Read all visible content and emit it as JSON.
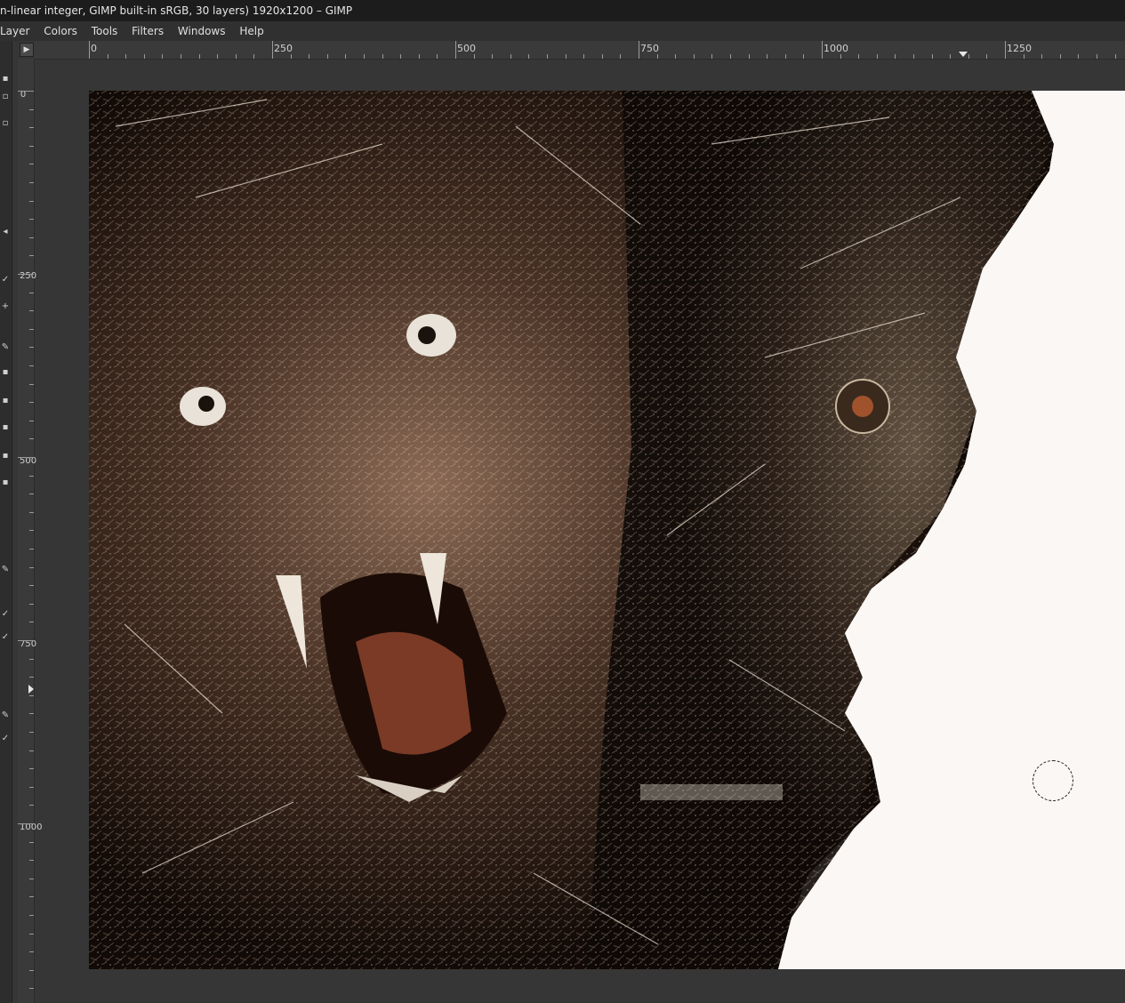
{
  "window": {
    "title": "n-linear integer, GIMP built-in sRGB, 30 layers) 1920x1200 – GIMP"
  },
  "menubar": {
    "items": [
      "Layer",
      "Colors",
      "Tools",
      "Filters",
      "Windows",
      "Help"
    ]
  },
  "rulers": {
    "horizontal_labels": [
      "0",
      "250",
      "500",
      "750",
      "1000",
      "1250"
    ],
    "vertical_labels": [
      "0",
      "250",
      "500",
      "750",
      "1000"
    ]
  },
  "canvas": {
    "background_color": "#fbf7f4",
    "artwork_description_icon": "tiger-skull-artwork"
  },
  "colors": {
    "ui_dark": "#1c1c1c",
    "ui_mid": "#3c3c3c",
    "canvas_white": "#fbf7f4"
  }
}
